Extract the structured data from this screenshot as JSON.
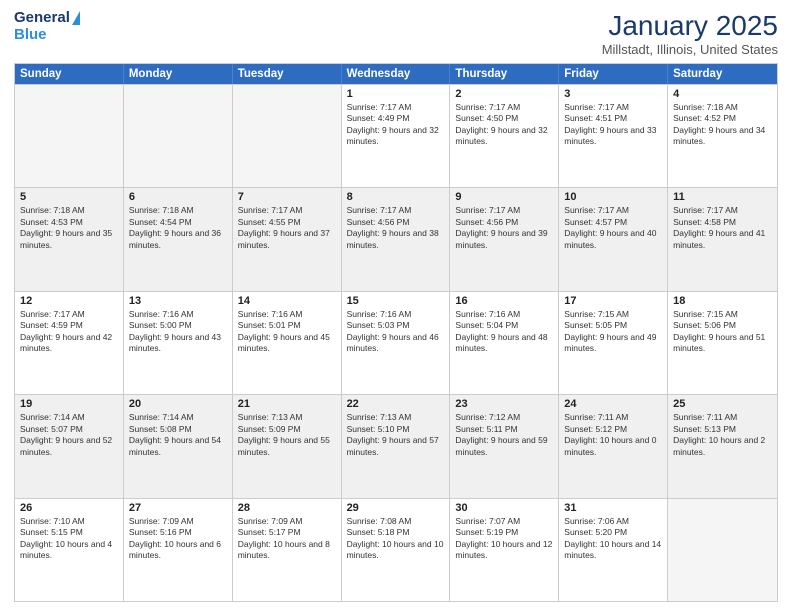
{
  "header": {
    "logo_line1": "General",
    "logo_line2": "Blue",
    "main_title": "January 2025",
    "sub_title": "Millstadt, Illinois, United States"
  },
  "calendar": {
    "days_of_week": [
      "Sunday",
      "Monday",
      "Tuesday",
      "Wednesday",
      "Thursday",
      "Friday",
      "Saturday"
    ],
    "rows": [
      [
        {
          "day": "",
          "empty": true
        },
        {
          "day": "",
          "empty": true
        },
        {
          "day": "",
          "empty": true
        },
        {
          "day": "1",
          "sunrise": "7:17 AM",
          "sunset": "4:49 PM",
          "daylight": "9 hours and 32 minutes."
        },
        {
          "day": "2",
          "sunrise": "7:17 AM",
          "sunset": "4:50 PM",
          "daylight": "9 hours and 32 minutes."
        },
        {
          "day": "3",
          "sunrise": "7:17 AM",
          "sunset": "4:51 PM",
          "daylight": "9 hours and 33 minutes."
        },
        {
          "day": "4",
          "sunrise": "7:18 AM",
          "sunset": "4:52 PM",
          "daylight": "9 hours and 34 minutes."
        }
      ],
      [
        {
          "day": "5",
          "sunrise": "7:18 AM",
          "sunset": "4:53 PM",
          "daylight": "9 hours and 35 minutes."
        },
        {
          "day": "6",
          "sunrise": "7:18 AM",
          "sunset": "4:54 PM",
          "daylight": "9 hours and 36 minutes."
        },
        {
          "day": "7",
          "sunrise": "7:17 AM",
          "sunset": "4:55 PM",
          "daylight": "9 hours and 37 minutes."
        },
        {
          "day": "8",
          "sunrise": "7:17 AM",
          "sunset": "4:56 PM",
          "daylight": "9 hours and 38 minutes."
        },
        {
          "day": "9",
          "sunrise": "7:17 AM",
          "sunset": "4:56 PM",
          "daylight": "9 hours and 39 minutes."
        },
        {
          "day": "10",
          "sunrise": "7:17 AM",
          "sunset": "4:57 PM",
          "daylight": "9 hours and 40 minutes."
        },
        {
          "day": "11",
          "sunrise": "7:17 AM",
          "sunset": "4:58 PM",
          "daylight": "9 hours and 41 minutes."
        }
      ],
      [
        {
          "day": "12",
          "sunrise": "7:17 AM",
          "sunset": "4:59 PM",
          "daylight": "9 hours and 42 minutes."
        },
        {
          "day": "13",
          "sunrise": "7:16 AM",
          "sunset": "5:00 PM",
          "daylight": "9 hours and 43 minutes."
        },
        {
          "day": "14",
          "sunrise": "7:16 AM",
          "sunset": "5:01 PM",
          "daylight": "9 hours and 45 minutes."
        },
        {
          "day": "15",
          "sunrise": "7:16 AM",
          "sunset": "5:03 PM",
          "daylight": "9 hours and 46 minutes."
        },
        {
          "day": "16",
          "sunrise": "7:16 AM",
          "sunset": "5:04 PM",
          "daylight": "9 hours and 48 minutes."
        },
        {
          "day": "17",
          "sunrise": "7:15 AM",
          "sunset": "5:05 PM",
          "daylight": "9 hours and 49 minutes."
        },
        {
          "day": "18",
          "sunrise": "7:15 AM",
          "sunset": "5:06 PM",
          "daylight": "9 hours and 51 minutes."
        }
      ],
      [
        {
          "day": "19",
          "sunrise": "7:14 AM",
          "sunset": "5:07 PM",
          "daylight": "9 hours and 52 minutes."
        },
        {
          "day": "20",
          "sunrise": "7:14 AM",
          "sunset": "5:08 PM",
          "daylight": "9 hours and 54 minutes."
        },
        {
          "day": "21",
          "sunrise": "7:13 AM",
          "sunset": "5:09 PM",
          "daylight": "9 hours and 55 minutes."
        },
        {
          "day": "22",
          "sunrise": "7:13 AM",
          "sunset": "5:10 PM",
          "daylight": "9 hours and 57 minutes."
        },
        {
          "day": "23",
          "sunrise": "7:12 AM",
          "sunset": "5:11 PM",
          "daylight": "9 hours and 59 minutes."
        },
        {
          "day": "24",
          "sunrise": "7:11 AM",
          "sunset": "5:12 PM",
          "daylight": "10 hours and 0 minutes."
        },
        {
          "day": "25",
          "sunrise": "7:11 AM",
          "sunset": "5:13 PM",
          "daylight": "10 hours and 2 minutes."
        }
      ],
      [
        {
          "day": "26",
          "sunrise": "7:10 AM",
          "sunset": "5:15 PM",
          "daylight": "10 hours and 4 minutes."
        },
        {
          "day": "27",
          "sunrise": "7:09 AM",
          "sunset": "5:16 PM",
          "daylight": "10 hours and 6 minutes."
        },
        {
          "day": "28",
          "sunrise": "7:09 AM",
          "sunset": "5:17 PM",
          "daylight": "10 hours and 8 minutes."
        },
        {
          "day": "29",
          "sunrise": "7:08 AM",
          "sunset": "5:18 PM",
          "daylight": "10 hours and 10 minutes."
        },
        {
          "day": "30",
          "sunrise": "7:07 AM",
          "sunset": "5:19 PM",
          "daylight": "10 hours and 12 minutes."
        },
        {
          "day": "31",
          "sunrise": "7:06 AM",
          "sunset": "5:20 PM",
          "daylight": "10 hours and 14 minutes."
        },
        {
          "day": "",
          "empty": true
        }
      ]
    ]
  }
}
